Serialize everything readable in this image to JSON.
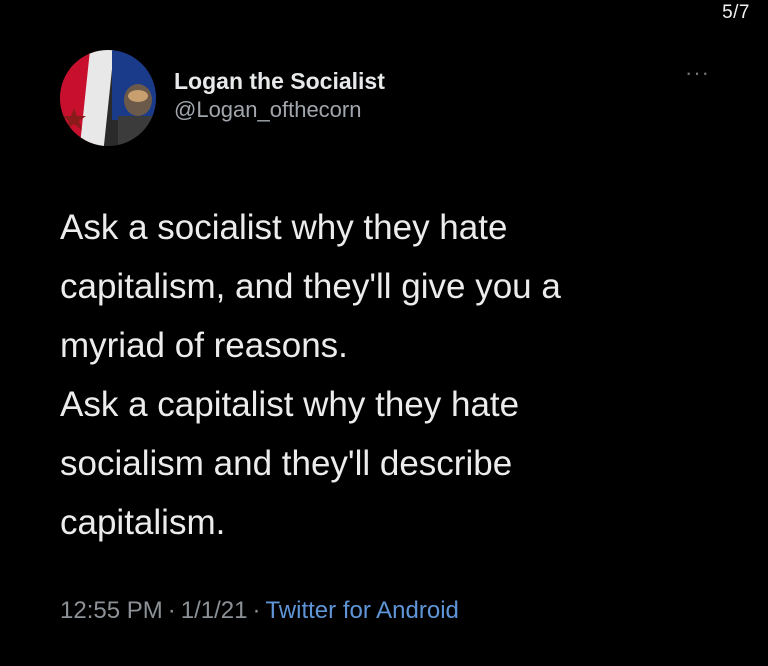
{
  "page_counter": "5/7",
  "tweet": {
    "display_name": "Logan the Socialist",
    "handle": "@Logan_ofthecorn",
    "more_icon": "more-horizontal-icon",
    "text_lines": [
      "Ask a socialist why they hate",
      "capitalism, and they'll give you a",
      "myriad of reasons.",
      "Ask a capitalist why they hate",
      "socialism and they'll describe",
      "capitalism."
    ],
    "time": "12:55 PM",
    "date": "1/1/21",
    "separator": "·",
    "source": "Twitter for Android"
  },
  "colors": {
    "background": "#000000",
    "text": "#e7e9ea",
    "secondary": "#8b9196",
    "link": "#5f95d6"
  }
}
